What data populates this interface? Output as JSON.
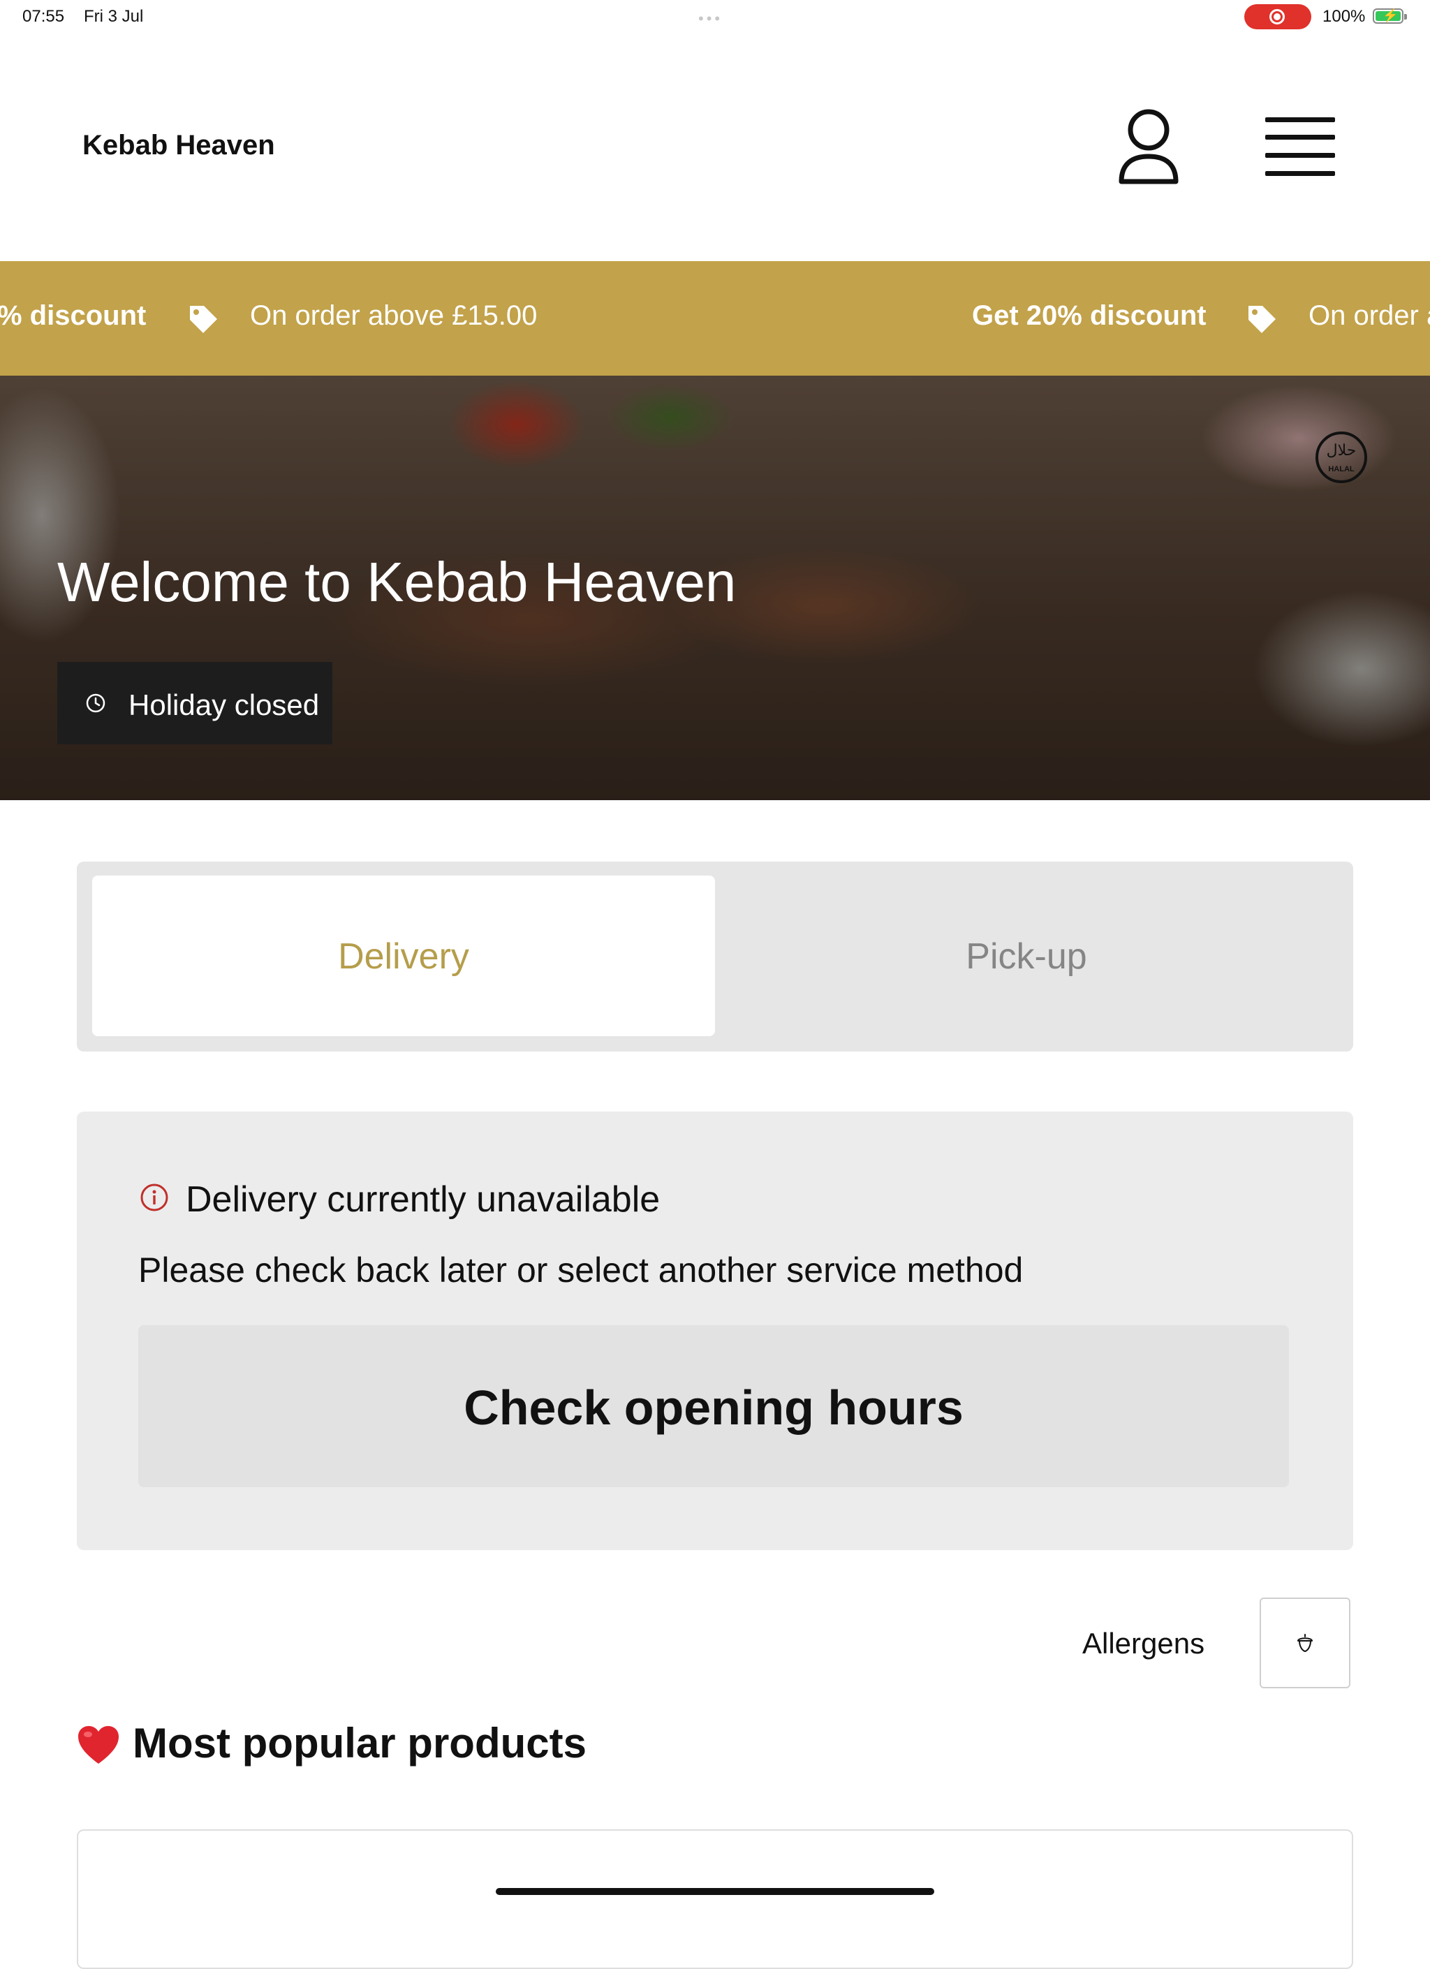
{
  "status_bar": {
    "time": "07:55",
    "date": "Fri 3 Jul",
    "battery": "100%"
  },
  "header": {
    "brand": "Kebab Heaven",
    "account_icon": "person-icon",
    "menu_icon": "hamburger-menu-icon"
  },
  "promo": {
    "items": [
      {
        "headline": "Get 20% discount",
        "detail": "On order above £15.00"
      },
      {
        "headline": "Get 20% discount",
        "detail": "On order above £15.00"
      }
    ],
    "visible": {
      "headline_clipped_left": "% discount",
      "detail_1": "On order above £15.00",
      "headline_2": "Get 20% discount",
      "detail_2_clipped_right": "On order a"
    },
    "tag_icon": "tag-icon"
  },
  "hero": {
    "title": "Welcome to Kebab Heaven",
    "status": "Holiday closed",
    "status_icon": "clock-icon",
    "badge_icon": "halal-badge-icon",
    "badge_arabic": "حلال",
    "badge_text": "HALAL"
  },
  "service": {
    "tabs": [
      {
        "label": "Delivery",
        "active": true
      },
      {
        "label": "Pick-up",
        "active": false
      }
    ]
  },
  "notice": {
    "icon": "info-icon",
    "title": "Delivery currently unavailable",
    "message": "Please check back later or select another service method",
    "button_label": "Check opening hours"
  },
  "allergens": {
    "label": "Allergens",
    "icon": "acorn-icon"
  },
  "popular": {
    "heading": "Most popular products",
    "icon": "heart-icon"
  },
  "colors": {
    "accent": "#c2a24a",
    "active_tab_text": "#b59d4b",
    "inactive_tab_text": "#858585",
    "info_red": "#c0302a"
  }
}
